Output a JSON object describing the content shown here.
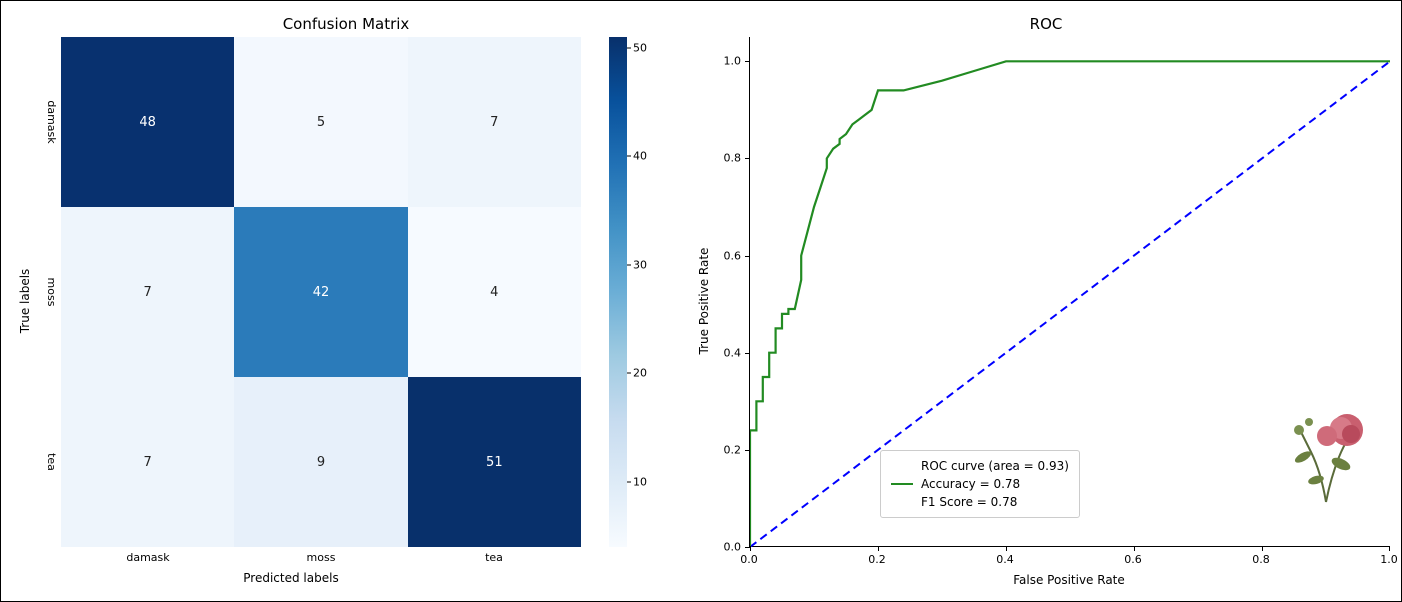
{
  "chart_data": [
    {
      "type": "heatmap",
      "title": "Confusion Matrix",
      "xlabel": "Predicted labels",
      "ylabel": "True labels",
      "x_categories": [
        "damask",
        "moss",
        "tea"
      ],
      "y_categories": [
        "damask",
        "moss",
        "tea"
      ],
      "values": [
        [
          48,
          5,
          7
        ],
        [
          7,
          42,
          4
        ],
        [
          7,
          9,
          51
        ]
      ],
      "colormap": "Blues",
      "colorbar": {
        "min": 4,
        "max": 51,
        "ticks": [
          10,
          20,
          30,
          40,
          50
        ]
      }
    },
    {
      "type": "line",
      "title": "ROC",
      "xlabel": "False Positive Rate",
      "ylabel": "True Positive Rate",
      "xlim": [
        0.0,
        1.0
      ],
      "ylim": [
        0.0,
        1.05
      ],
      "xticks": [
        0.0,
        0.2,
        0.4,
        0.6,
        0.8,
        1.0
      ],
      "yticks": [
        0.0,
        0.2,
        0.4,
        0.6,
        0.8,
        1.0
      ],
      "series": [
        {
          "name": "ROC curve (area = 0.93)",
          "color": "#228B22",
          "x": [
            0.0,
            0.0,
            0.01,
            0.01,
            0.02,
            0.02,
            0.03,
            0.03,
            0.04,
            0.04,
            0.05,
            0.05,
            0.06,
            0.06,
            0.07,
            0.08,
            0.08,
            0.09,
            0.1,
            0.11,
            0.12,
            0.12,
            0.13,
            0.14,
            0.14,
            0.15,
            0.16,
            0.17,
            0.18,
            0.19,
            0.2,
            0.21,
            0.22,
            0.23,
            0.24,
            0.3,
            0.35,
            0.4,
            1.0
          ],
          "y": [
            0.0,
            0.24,
            0.24,
            0.3,
            0.3,
            0.35,
            0.35,
            0.4,
            0.4,
            0.45,
            0.45,
            0.48,
            0.48,
            0.49,
            0.49,
            0.55,
            0.6,
            0.65,
            0.7,
            0.74,
            0.78,
            0.8,
            0.82,
            0.83,
            0.84,
            0.85,
            0.87,
            0.88,
            0.89,
            0.9,
            0.94,
            0.94,
            0.94,
            0.94,
            0.94,
            0.96,
            0.98,
            1.0,
            1.0
          ]
        },
        {
          "name": "reference",
          "color": "#0000ff",
          "style": "dashed",
          "x": [
            0.0,
            1.0
          ],
          "y": [
            0.0,
            1.0
          ]
        }
      ],
      "legend": {
        "position": "lower center",
        "entries": [
          "ROC curve (area = 0.93)",
          "Accuracy = 0.78",
          "F1 Score = 0.78"
        ]
      },
      "annotations": [
        {
          "type": "image",
          "name": "rose-illustration",
          "position": "lower right"
        }
      ]
    }
  ],
  "cm": {
    "title": "Confusion Matrix",
    "xlabel": "Predicted labels",
    "ylabel": "True labels",
    "labels": [
      "damask",
      "moss",
      "tea"
    ],
    "cells": {
      "r0c0": "48",
      "r0c1": "5",
      "r0c2": "7",
      "r1c0": "7",
      "r1c1": "42",
      "r1c2": "4",
      "r2c0": "7",
      "r2c1": "9",
      "r2c2": "51"
    },
    "cbar_ticks": {
      "t0": "10",
      "t1": "20",
      "t2": "30",
      "t3": "40",
      "t4": "50"
    }
  },
  "roc": {
    "title": "ROC",
    "xlabel": "False Positive Rate",
    "ylabel": "True Positive Rate",
    "legend": {
      "l0": "ROC curve (area = 0.93)",
      "l1": "Accuracy = 0.78",
      "l2": "F1 Score = 0.78"
    },
    "xticks": {
      "t0": "0.0",
      "t1": "0.2",
      "t2": "0.4",
      "t3": "0.6",
      "t4": "0.8",
      "t5": "1.0"
    },
    "yticks": {
      "t0": "0.0",
      "t1": "0.2",
      "t2": "0.4",
      "t3": "0.6",
      "t4": "0.8",
      "t5": "1.0"
    }
  }
}
